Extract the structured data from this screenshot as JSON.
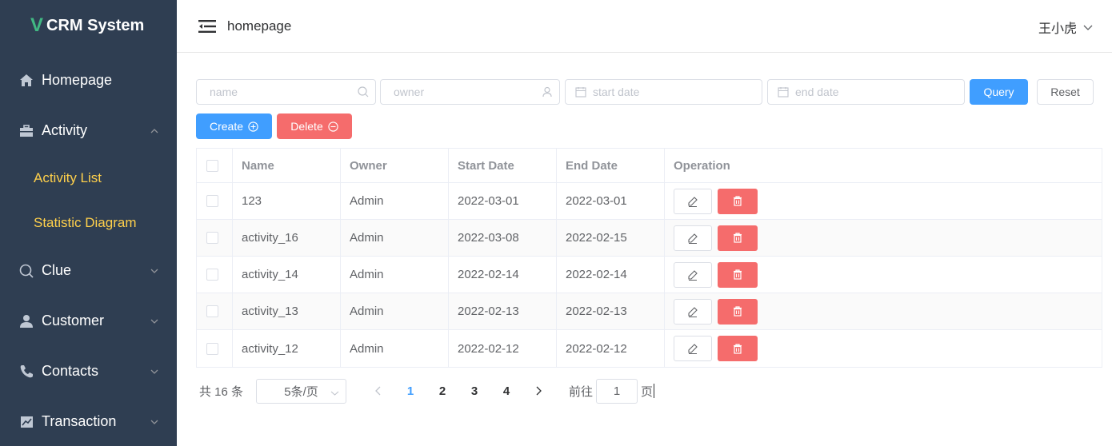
{
  "app": {
    "logo_mark": "V",
    "title": "CRM System"
  },
  "sidebar": {
    "items": [
      {
        "label": "Homepage",
        "icon": "home-icon"
      },
      {
        "label": "Activity",
        "icon": "briefcase-icon",
        "expanded": true,
        "children": [
          {
            "label": "Activity List"
          },
          {
            "label": "Statistic Diagram"
          }
        ]
      },
      {
        "label": "Clue",
        "icon": "search-icon"
      },
      {
        "label": "Customer",
        "icon": "user-icon"
      },
      {
        "label": "Contacts",
        "icon": "phone-icon"
      },
      {
        "label": "Transaction",
        "icon": "chart-icon"
      }
    ]
  },
  "header": {
    "breadcrumb": "homepage",
    "user": "王小虎"
  },
  "filters": {
    "name_placeholder": "name",
    "owner_placeholder": "owner",
    "start_placeholder": "start date",
    "end_placeholder": "end date",
    "query_label": "Query",
    "reset_label": "Reset"
  },
  "actions": {
    "create_label": "Create",
    "delete_label": "Delete"
  },
  "table": {
    "columns": [
      "Name",
      "Owner",
      "Start Date",
      "End Date",
      "Operation"
    ],
    "rows": [
      {
        "name": "123",
        "owner": "Admin",
        "start": "2022-03-01",
        "end": "2022-03-01"
      },
      {
        "name": "activity_16",
        "owner": "Admin",
        "start": "2022-03-08",
        "end": "2022-02-15"
      },
      {
        "name": "activity_14",
        "owner": "Admin",
        "start": "2022-02-14",
        "end": "2022-02-14"
      },
      {
        "name": "activity_13",
        "owner": "Admin",
        "start": "2022-02-13",
        "end": "2022-02-13"
      },
      {
        "name": "activity_12",
        "owner": "Admin",
        "start": "2022-02-12",
        "end": "2022-02-12"
      }
    ]
  },
  "pagination": {
    "total_text": "共 16 条",
    "page_size": "5条/页",
    "pages": [
      "1",
      "2",
      "3",
      "4"
    ],
    "current": "1",
    "goto_prefix": "前往",
    "goto_value": "1",
    "goto_suffix": "页"
  },
  "colors": {
    "sidebar": "#2f3e52",
    "active_submenu": "#ffd04b",
    "primary": "#409eff",
    "danger": "#f56c6c"
  }
}
